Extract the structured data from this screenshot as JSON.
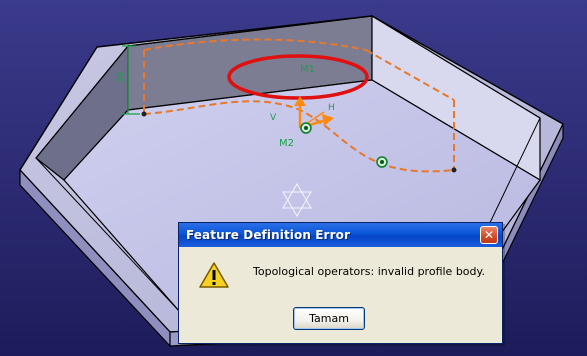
{
  "viewport": {
    "background_colors": [
      "#3b3a8c",
      "#1d1c5a"
    ],
    "labels": {
      "dimension_value": "30",
      "constraint_top": "M1",
      "constraint_mid": "M2",
      "axis_h": "H",
      "axis_v": "V"
    },
    "colors": {
      "profile_curve": "#e8782a",
      "highlight_ellipse": "#e01010",
      "constraint": "#1aa04a",
      "compass": "#ff8a10"
    }
  },
  "dialog": {
    "title": "Feature Definition Error",
    "close_symbol": "✕",
    "icon": "warning-icon",
    "message": "Topological operators: invalid profile body.",
    "ok_label": "Tamam"
  }
}
